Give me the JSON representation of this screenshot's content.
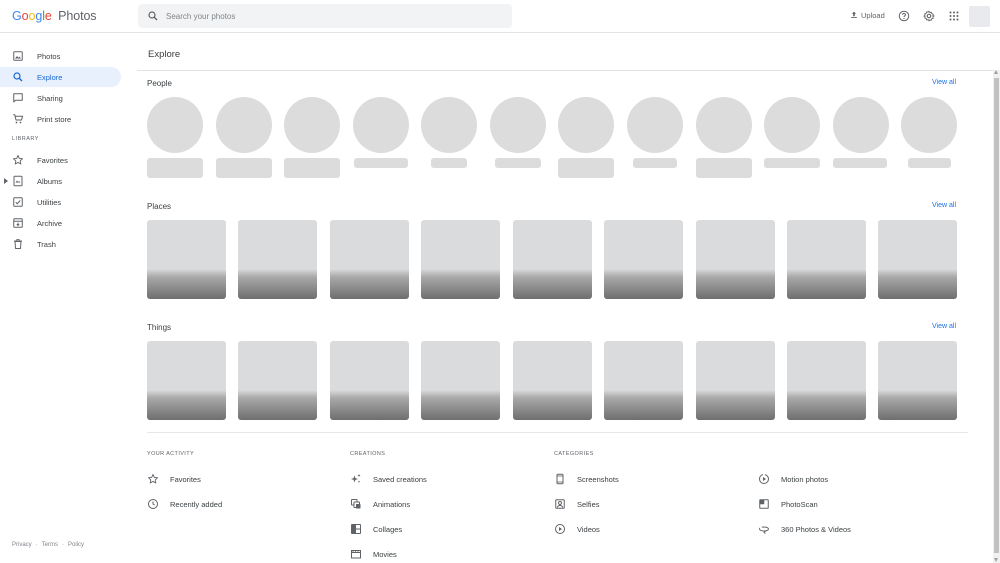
{
  "header": {
    "logo_google": "Google",
    "logo_photos": "Photos",
    "search_placeholder": "Search your photos",
    "upload_label": "Upload"
  },
  "sidebar": {
    "items": [
      {
        "label": "Photos",
        "icon": "photo-icon"
      },
      {
        "label": "Explore",
        "icon": "search-icon",
        "active": true
      },
      {
        "label": "Sharing",
        "icon": "chat-icon"
      },
      {
        "label": "Print store",
        "icon": "cart-icon"
      }
    ],
    "library_label": "LIBRARY",
    "library_items": [
      {
        "label": "Favorites",
        "icon": "star-icon"
      },
      {
        "label": "Albums",
        "icon": "album-icon"
      },
      {
        "label": "Utilities",
        "icon": "utilities-icon"
      },
      {
        "label": "Archive",
        "icon": "archive-icon"
      },
      {
        "label": "Trash",
        "icon": "trash-icon"
      }
    ],
    "footer": [
      "Privacy",
      "·",
      "Terms",
      "·",
      "Policy"
    ]
  },
  "main": {
    "title": "Explore",
    "people_title": "People",
    "places_title": "Places",
    "things_title": "Things",
    "view_all": "View all",
    "your_activity_label": "YOUR ACTIVITY",
    "creations_label": "CREATIONS",
    "categories_label": "CATEGORIES",
    "activity": [
      {
        "label": "Favorites",
        "icon": "star-icon"
      },
      {
        "label": "Recently added",
        "icon": "clock-icon"
      }
    ],
    "creations": [
      {
        "label": "Saved creations",
        "icon": "sparkle-icon"
      },
      {
        "label": "Animations",
        "icon": "animation-icon"
      },
      {
        "label": "Collages",
        "icon": "collage-icon"
      },
      {
        "label": "Movies",
        "icon": "movie-icon"
      }
    ],
    "categories_col1": [
      {
        "label": "Screenshots",
        "icon": "phone-icon"
      },
      {
        "label": "Selfies",
        "icon": "selfie-icon"
      },
      {
        "label": "Videos",
        "icon": "play-icon"
      }
    ],
    "categories_col2": [
      {
        "label": "Motion photos",
        "icon": "motion-icon"
      },
      {
        "label": "PhotoScan",
        "icon": "photoscan-icon"
      },
      {
        "label": "360 Photos & Videos",
        "icon": "360-icon"
      }
    ]
  },
  "colors": {
    "accent": "#1a73e8",
    "active_bg": "#e8f0fe",
    "placeholder": "#dcdcdc"
  }
}
